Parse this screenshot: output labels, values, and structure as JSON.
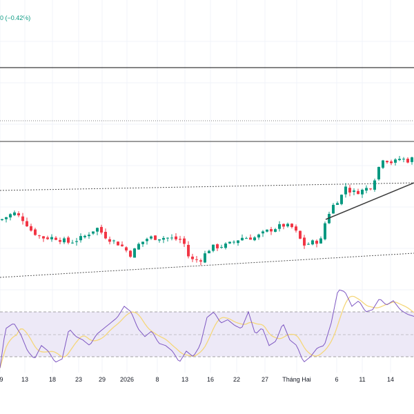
{
  "legend": {
    "change_text": "0 (−0.42%)",
    "color": "#089981"
  },
  "colors": {
    "up": "#089981",
    "down": "#f23645",
    "rsi": "#7e57c2",
    "rsi_ma": "#f5d77a",
    "rsi_band": "#ede9f7",
    "lines": "#3a3a3a"
  },
  "x_axis": {
    "labels": [
      "9",
      "13",
      "18",
      "23",
      "29",
      "2026",
      "8",
      "13",
      "16",
      "22",
      "27",
      "Tháng Hai",
      "6",
      "11",
      "14"
    ]
  },
  "chart_data": {
    "type": "candlestick",
    "note": "relative price level 0-100 within visible pane",
    "close_keypoints": [
      [
        0,
        28
      ],
      [
        20,
        31
      ],
      [
        35,
        28
      ],
      [
        45,
        24
      ],
      [
        60,
        21
      ],
      [
        80,
        21
      ],
      [
        100,
        19
      ],
      [
        120,
        21
      ],
      [
        140,
        25
      ],
      [
        155,
        21
      ],
      [
        175,
        18
      ],
      [
        190,
        14
      ],
      [
        200,
        18
      ],
      [
        215,
        21
      ],
      [
        240,
        21
      ],
      [
        265,
        20
      ],
      [
        275,
        12
      ],
      [
        290,
        12
      ],
      [
        305,
        17
      ],
      [
        330,
        18
      ],
      [
        350,
        21
      ],
      [
        370,
        21
      ],
      [
        390,
        24
      ],
      [
        410,
        26
      ],
      [
        425,
        25
      ],
      [
        440,
        18
      ],
      [
        465,
        20
      ],
      [
        472,
        28
      ],
      [
        480,
        33
      ],
      [
        495,
        38
      ],
      [
        500,
        42
      ],
      [
        510,
        39
      ],
      [
        525,
        40
      ],
      [
        540,
        42
      ],
      [
        545,
        47
      ],
      [
        555,
        53
      ],
      [
        570,
        51
      ],
      [
        580,
        53
      ],
      [
        590,
        52
      ],
      [
        600,
        53
      ]
    ],
    "rsi_keypoints": [
      [
        0,
        20
      ],
      [
        8,
        55
      ],
      [
        20,
        60
      ],
      [
        30,
        50
      ],
      [
        40,
        35
      ],
      [
        50,
        28
      ],
      [
        60,
        40
      ],
      [
        70,
        35
      ],
      [
        80,
        25
      ],
      [
        90,
        28
      ],
      [
        100,
        55
      ],
      [
        110,
        48
      ],
      [
        120,
        45
      ],
      [
        130,
        40
      ],
      [
        140,
        50
      ],
      [
        150,
        55
      ],
      [
        160,
        60
      ],
      [
        170,
        65
      ],
      [
        180,
        75
      ],
      [
        190,
        70
      ],
      [
        200,
        55
      ],
      [
        210,
        48
      ],
      [
        220,
        53
      ],
      [
        230,
        42
      ],
      [
        240,
        40
      ],
      [
        250,
        35
      ],
      [
        260,
        25
      ],
      [
        270,
        35
      ],
      [
        280,
        30
      ],
      [
        290,
        40
      ],
      [
        300,
        65
      ],
      [
        310,
        70
      ],
      [
        320,
        60
      ],
      [
        330,
        63
      ],
      [
        340,
        58
      ],
      [
        350,
        55
      ],
      [
        360,
        70
      ],
      [
        370,
        50
      ],
      [
        380,
        56
      ],
      [
        390,
        40
      ],
      [
        400,
        44
      ],
      [
        410,
        60
      ],
      [
        420,
        45
      ],
      [
        430,
        40
      ],
      [
        440,
        25
      ],
      [
        450,
        30
      ],
      [
        460,
        38
      ],
      [
        470,
        40
      ],
      [
        480,
        60
      ],
      [
        490,
        90
      ],
      [
        500,
        88
      ],
      [
        510,
        75
      ],
      [
        520,
        80
      ],
      [
        530,
        70
      ],
      [
        540,
        72
      ],
      [
        550,
        82
      ],
      [
        560,
        76
      ],
      [
        570,
        80
      ],
      [
        580,
        72
      ],
      [
        590,
        68
      ],
      [
        600,
        66
      ]
    ],
    "rsi_levels": [
      70,
      50,
      30
    ]
  }
}
